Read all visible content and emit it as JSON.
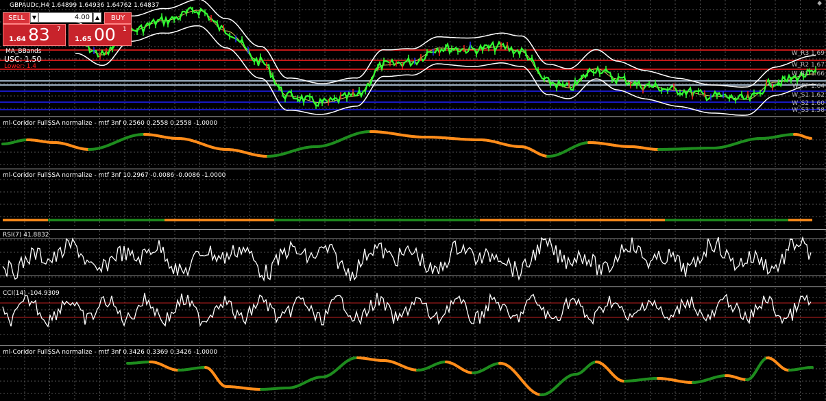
{
  "chart_title": "GBPAUDc,H4  1.64899 1.64936 1.64762 1.64837",
  "trade_panel": {
    "sell_label": "SELL",
    "buy_label": "BUY",
    "lot_value": "4.00",
    "spin_down": "▼",
    "spin_up": "▲",
    "sell_small": "1.64",
    "sell_big": "83",
    "sell_sup": "7",
    "buy_small": "1.65",
    "buy_big": "00",
    "buy_sup": "1"
  },
  "main_labels": {
    "ma_bbands": "MA_BBands",
    "usc": "USC: 1.50",
    "lower": "Lower: 1.4"
  },
  "levels": [
    {
      "text": "W_R3 1.69"
    },
    {
      "text": "W_R2 1.67"
    },
    {
      "text": "W_R1 1.66"
    },
    {
      "text": "W_PP 1.64"
    },
    {
      "text": "W_S1 1.62"
    },
    {
      "text": "W_S2 1.60"
    },
    {
      "text": "W_S3 1.58"
    }
  ],
  "indicators": {
    "ssa1": "ml-Coridor FullSSA normalize - mtf 3nf 0.2560 0.2558 0.2558 -1.0000",
    "ssa2": "ml-Coridor FullSSA normalize - mtf 3nf 10.2967 -0.0086 -0.0086 -1.0000",
    "rsi": "RSI(7) 41.8832",
    "cci": "CCI(14) -104.9309",
    "ssa3": "ml-Coridor FullSSA normalize - mtf 3nf 0.3426 0.3369 0.3426 -1.0000"
  },
  "colors": {
    "up": "#1e8c1e",
    "down": "#ff8c1a",
    "grid": "#555555",
    "price": "#33ff33",
    "band": "#ffffff",
    "red_level": "#ff2020",
    "blue_level": "#2020ff"
  }
}
